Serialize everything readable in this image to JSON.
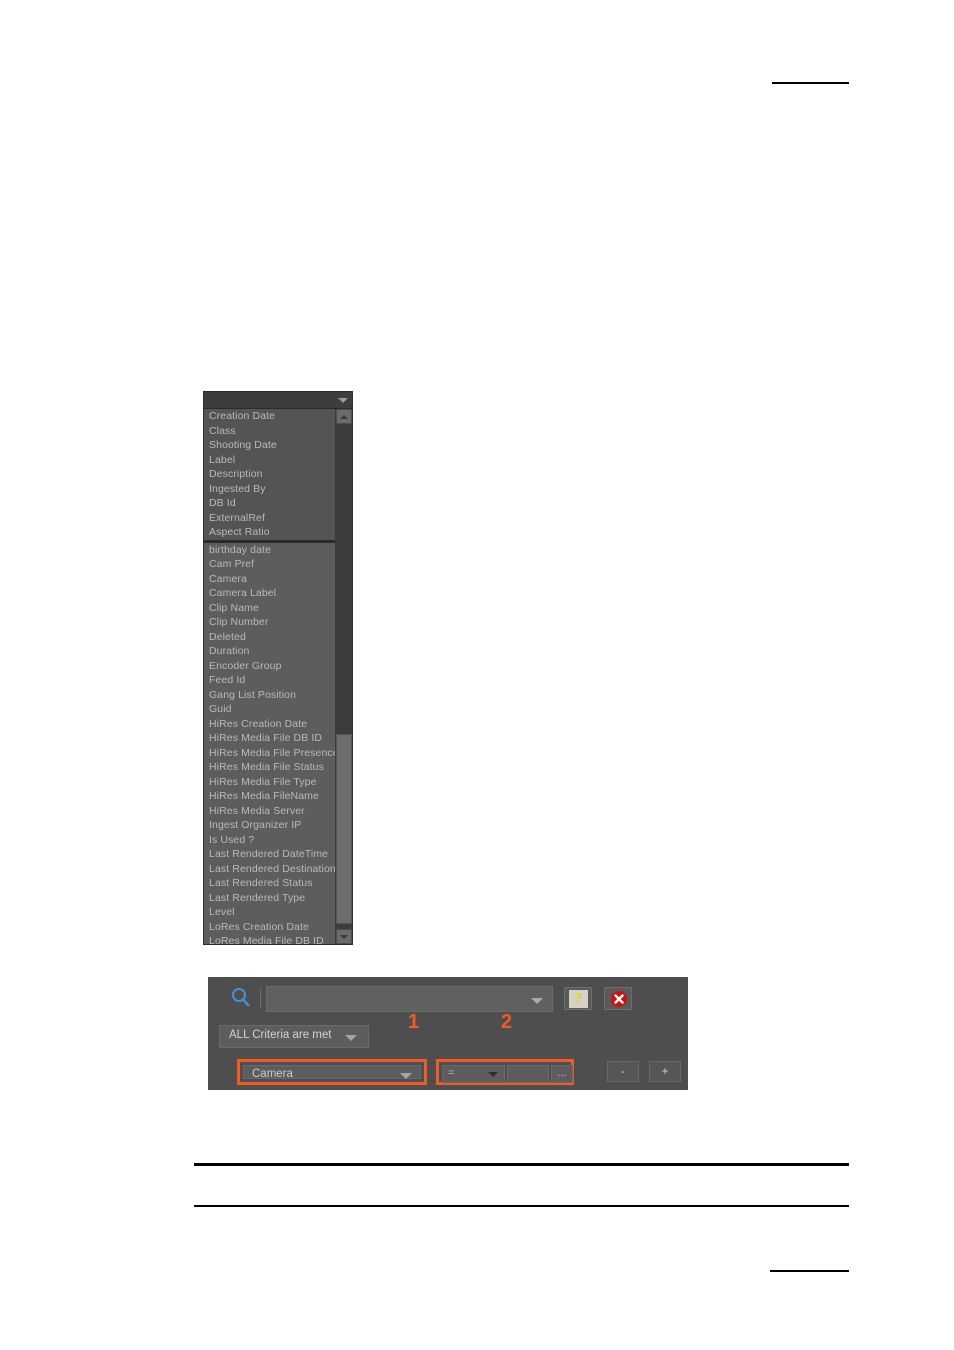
{
  "metadata_dropdown": {
    "header_icon": "chevron-down-icon",
    "recent_items": [
      "Creation Date",
      "Class",
      "Shooting Date",
      "Label",
      "Description",
      "Ingested By",
      "DB Id",
      "ExternalRef",
      "Aspect Ratio"
    ],
    "all_items": [
      "birthday date",
      "Cam Pref",
      "Camera",
      "Camera Label",
      "Clip Name",
      "Clip Number",
      "Deleted",
      "Duration",
      "Encoder Group",
      "Feed Id",
      "Gang List Position",
      "Guid",
      "HiRes Creation Date",
      "HiRes Media File DB ID",
      "HiRes Media File Presence",
      "HiRes Media File Status",
      "HiRes Media File Type",
      "HiRes Media FileName",
      "HiRes Media Server",
      "Ingest Organizer IP",
      "Is Used ?",
      "Last Rendered DateTime",
      "Last Rendered Destination",
      "Last Rendered Status",
      "Last Rendered Type",
      "Level",
      "LoRes Creation Date",
      "LoRes Media File DB ID"
    ],
    "scrollbar": {
      "up_icon": "scroll-up-arrow-icon",
      "down_icon": "scroll-down-arrow-icon"
    }
  },
  "search_panel": {
    "search_icon": "search-magnifier-icon",
    "search_box": {
      "value": "",
      "placeholder": "",
      "arrow_icon": "chevron-down-icon"
    },
    "help_button": {
      "label": "?",
      "icon": "help-question-icon"
    },
    "close_button": {
      "icon": "close-error-icon"
    },
    "criteria_mode": {
      "value": "ALL Criteria are met",
      "arrow_icon": "chevron-down-icon"
    },
    "criterion_row": {
      "field": {
        "value": "Camera",
        "arrow_icon": "chevron-down-icon"
      },
      "operator": {
        "value": "=",
        "arrow_icon": "chevron-down-icon"
      },
      "value_input": {
        "value": "",
        "placeholder": ""
      },
      "browse_button": {
        "label": "..."
      }
    },
    "remove_button": {
      "label": "-"
    },
    "add_button": {
      "label": "+"
    },
    "callouts": [
      {
        "number": "1"
      },
      {
        "number": "2"
      }
    ],
    "accent_color": "#ef5a28"
  }
}
